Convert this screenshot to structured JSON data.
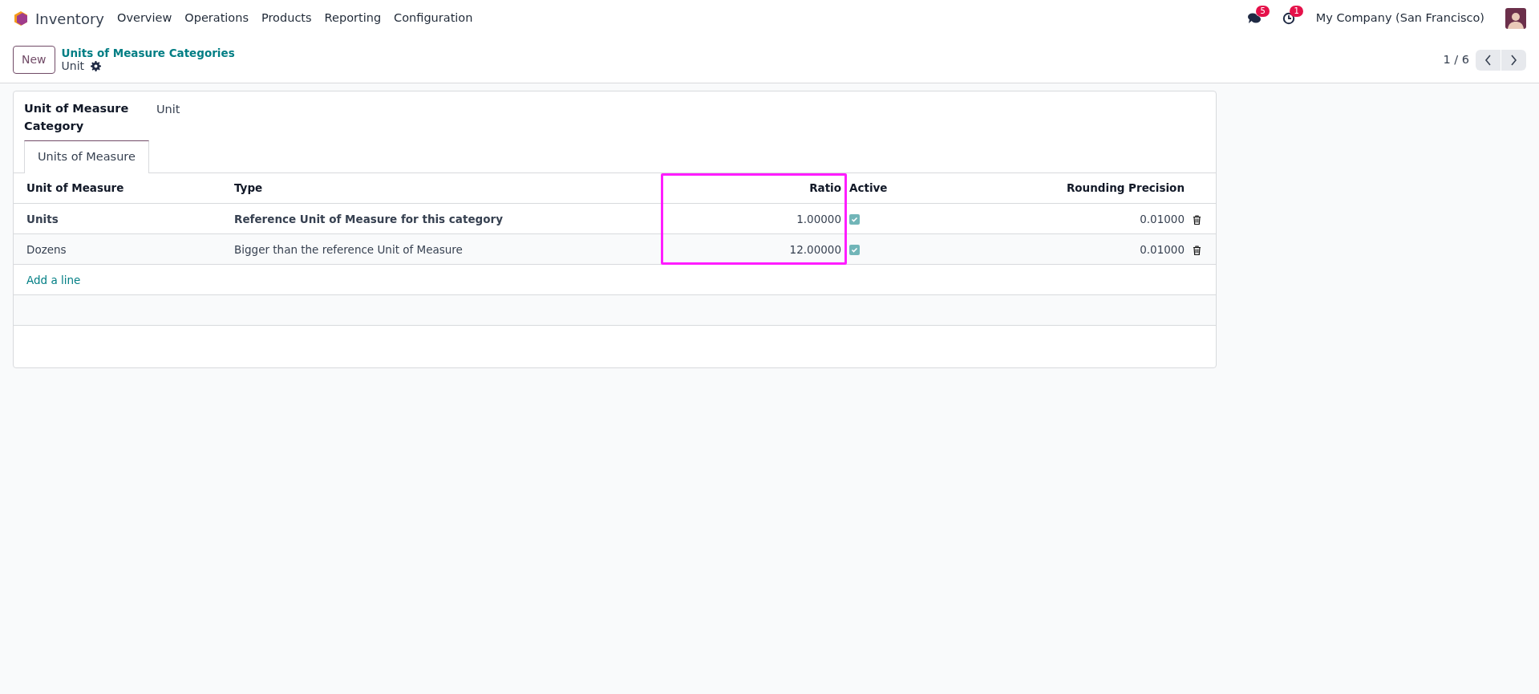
{
  "navbar": {
    "app": "Inventory",
    "menu": [
      "Overview",
      "Operations",
      "Products",
      "Reporting",
      "Configuration"
    ],
    "messages_count": "5",
    "activities_count": "1",
    "company": "My Company (San Francisco)"
  },
  "control_panel": {
    "new_button": "New",
    "breadcrumb": "Units of Measure Categories",
    "record": "Unit",
    "pager": "1 / 6"
  },
  "form": {
    "field_label": "Unit of Measure Category",
    "field_value": "Unit",
    "tabs": [
      {
        "label": "Units of Measure",
        "selected": true
      }
    ],
    "table": {
      "columns": [
        {
          "label": "Unit of Measure",
          "kind": "text",
          "highlighted": false
        },
        {
          "label": "Type",
          "kind": "text",
          "highlighted": false
        },
        {
          "label": "Ratio",
          "kind": "number",
          "highlighted": true
        },
        {
          "label": "Active",
          "kind": "checkbox",
          "highlighted": false
        },
        {
          "label": "Rounding Precision",
          "kind": "number",
          "highlighted": false
        }
      ],
      "rows": [
        {
          "unit": "Units",
          "type": "Reference Unit of Measure for this category",
          "ratio": "1.00000",
          "active": true,
          "rounding": "0.01000",
          "reference": true
        },
        {
          "unit": "Dozens",
          "type": "Bigger than the reference Unit of Measure",
          "ratio": "12.00000",
          "active": true,
          "rounding": "0.01000",
          "reference": false
        }
      ],
      "add_line": "Add a line"
    }
  }
}
